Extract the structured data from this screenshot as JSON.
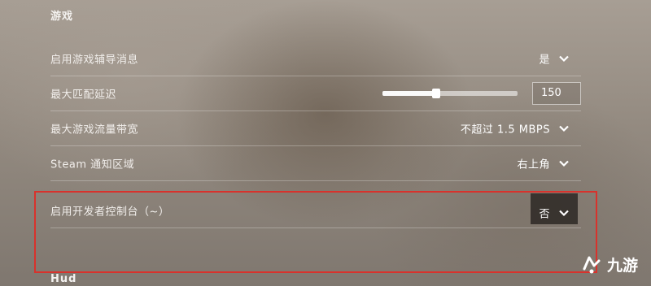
{
  "sections": {
    "game_title": "游戏",
    "hud_title": "Hud"
  },
  "settings": {
    "tutorial_messages": {
      "label": "启用游戏辅导消息",
      "value": "是"
    },
    "max_matchmaking_ping": {
      "label": "最大匹配延迟",
      "value": "150",
      "slider_fraction": 0.4
    },
    "max_bandwidth": {
      "label": "最大游戏流量带宽",
      "value": "不超过 1.5 MBPS"
    },
    "steam_notification_area": {
      "label": "Steam 通知区域",
      "value": "右上角"
    },
    "developer_console": {
      "label": "启用开发者控制台（~）",
      "value": "否"
    }
  },
  "highlight_color": "#d8322c",
  "watermark": {
    "text": "九游",
    "icon": "jiuyou-logo-icon"
  }
}
